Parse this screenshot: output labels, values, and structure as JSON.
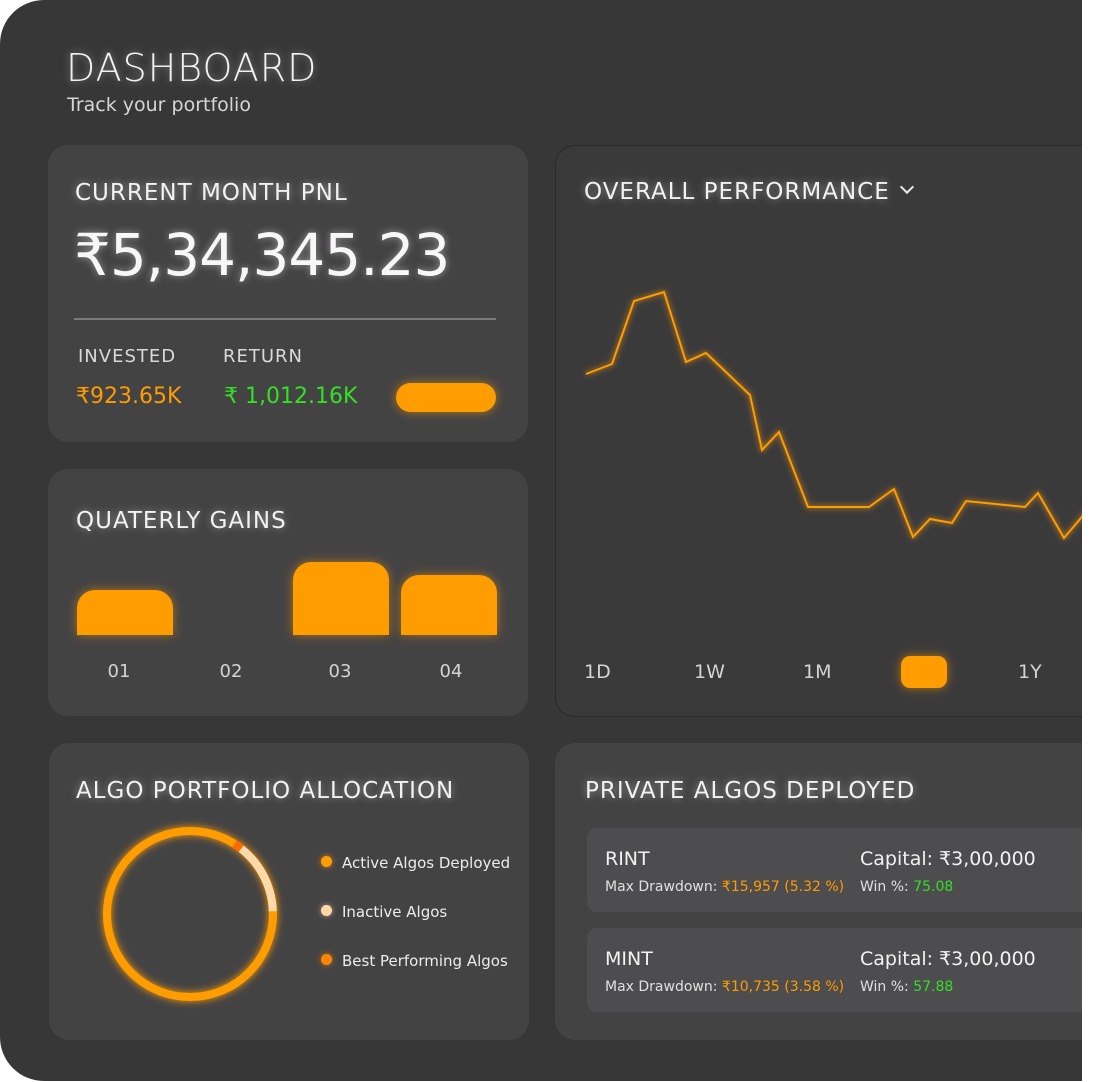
{
  "header": {
    "title": "DASHBOARD",
    "subtitle": "Track your portfolio"
  },
  "pnl": {
    "title": "CURRENT MONTH PNL",
    "value": "₹5,34,345.23",
    "invested_label": "INVESTED",
    "invested_value": "₹923.65K",
    "return_label": "RETURN",
    "return_value": "₹ 1,012.16K"
  },
  "quarterly": {
    "title": "QUATERLY GAINS",
    "quarters": [
      {
        "label": "01",
        "level": 0.62
      },
      {
        "label": "02",
        "level": 0
      },
      {
        "label": "03",
        "level": 1.0
      },
      {
        "label": "04",
        "level": 0.82
      }
    ]
  },
  "performance": {
    "title": "OVERALL PERFORMANCE",
    "timeframes": [
      "1D",
      "1W",
      "1M",
      "",
      "1Y"
    ],
    "active_timeframe_index": 3
  },
  "allocation": {
    "title": "ALGO PORTFOLIO ALLOCATION",
    "legend": [
      {
        "label": "Active Algos Deployed",
        "color": "#ff9c00"
      },
      {
        "label": "Inactive Algos",
        "color": "#ffd9a8"
      },
      {
        "label": "Best Performing Algos",
        "color": "#ff8400"
      }
    ]
  },
  "private_algos": {
    "title": "PRIVATE ALGOS DEPLOYED",
    "items": [
      {
        "name": "RINT",
        "capital": "Capital: ₹3,00,000",
        "drawdown_label": "Max Drawdown:",
        "drawdown_value": "₹15,957  (5.32 %)",
        "win_label": "Win %:",
        "win_value": "75.08"
      },
      {
        "name": "MINT",
        "capital": "Capital: ₹3,00,000",
        "drawdown_label": "Max Drawdown:",
        "drawdown_value": "₹10,735  (3.58 %)",
        "win_label": "Win %:",
        "win_value": "57.88"
      }
    ]
  },
  "colors": {
    "accent": "#ff9c00",
    "positive": "#34e024",
    "background": "#383738",
    "card": "#444344"
  }
}
